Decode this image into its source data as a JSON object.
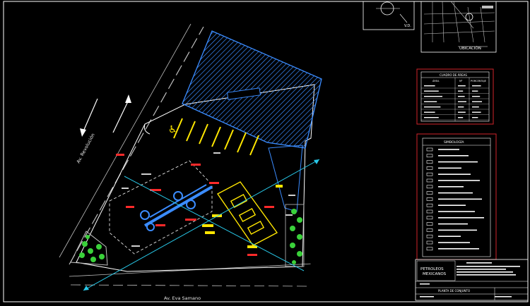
{
  "colors": {
    "background": "#000000",
    "frame": "#ffffff",
    "panel_border": "#d0232a",
    "building": "#3b8cff",
    "parking": "#ffe600",
    "green": "#3ad13a",
    "cyan": "#28c8e8",
    "red": "#ff2a2a"
  },
  "labels": {
    "street_left": "Av. Revolución",
    "street_bottom": "Av. Eva Samano",
    "vd_label": "V.D.",
    "location_title": "UBICACIÓN",
    "areas_title": "CUADRO DE ÁREAS",
    "symbols_title": "SIMBOLOGÍA",
    "company_name": "PETROLEOS MEXICANOS",
    "plan_title": "PLANTA DE CONJUNTO"
  },
  "areas_table": {
    "headers": [
      "ÁREA",
      "M²",
      "PORCENTAJE"
    ]
  },
  "symbol_rows": 17,
  "icons": [
    "arrow-up-icon",
    "arrow-down-icon",
    "accessibility-icon",
    "north-arrow-icon"
  ]
}
